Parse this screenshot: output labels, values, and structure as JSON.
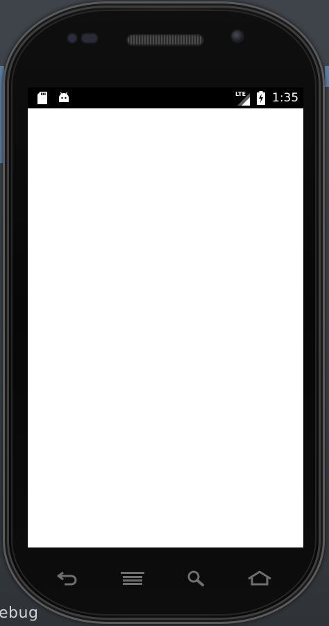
{
  "ide": {
    "bottom_text": "ebug"
  },
  "status_bar": {
    "network_type": "LTE",
    "time": "1:35",
    "icons": [
      "sd-card-icon",
      "android-debug-icon",
      "signal-icon",
      "battery-charging-icon"
    ]
  },
  "screen": {
    "background": "#ffffff",
    "content": ""
  },
  "navigation": {
    "buttons": [
      {
        "name": "back",
        "icon": "back-arrow-icon"
      },
      {
        "name": "menu",
        "icon": "menu-icon"
      },
      {
        "name": "search",
        "icon": "search-icon"
      },
      {
        "name": "home",
        "icon": "home-icon"
      }
    ]
  },
  "colors": {
    "phone_body": "#0b0b0b",
    "ide_background": "#3b4045",
    "status_bar": "#000000",
    "status_text": "#ffffff",
    "nav_icon": "#6e6e6e"
  }
}
